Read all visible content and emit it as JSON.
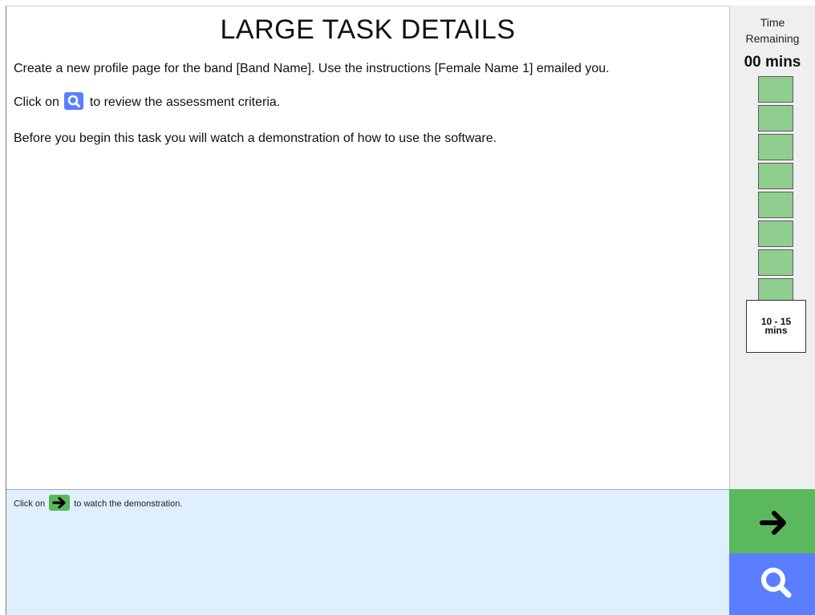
{
  "task": {
    "title": "LARGE TASK DETAILS",
    "line1": "Create a new profile page for the band [Band Name]. Use the instructions [Female Name 1] emailed you.",
    "line2_before": "Click on",
    "line2_after": "to review the assessment criteria.",
    "line3": "Before you begin this task you will watch a demonstration of how to use the software."
  },
  "timer": {
    "label": "Time Remaining",
    "value": "00 mins",
    "block_count": 8,
    "block_color": "#8fce8f",
    "estimate_line1": "10 - 15",
    "estimate_line2": "mins"
  },
  "instruction": {
    "before": "Click on",
    "after": "to watch the demonstration."
  },
  "buttons": {
    "next_icon": "arrow-right-icon",
    "search_icon": "search-icon"
  },
  "colors": {
    "green": "#5cb85c",
    "blue": "#5a7eff",
    "instruction_bg": "#dfeffd"
  }
}
